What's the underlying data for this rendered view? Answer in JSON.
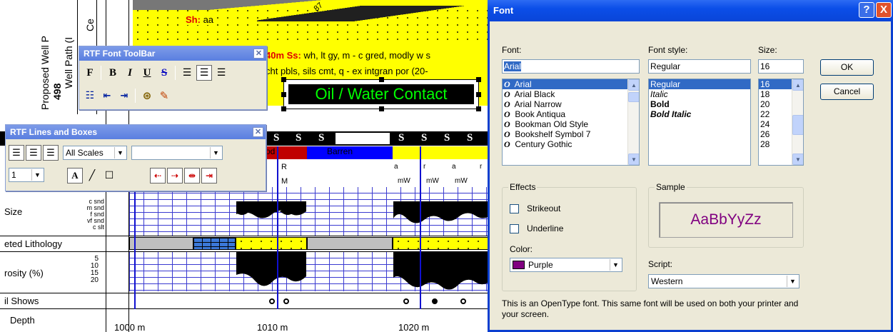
{
  "log": {
    "vertical_titles": [
      "Proposed Well P",
      "498",
      "Well Path (I",
      "Ce"
    ],
    "top_text": {
      "sh_prefix": "Sh:",
      "sh_value": "aa",
      "ss_prefix": "40m Ss:",
      "ss_line1": "wh, lt gy, m - c gred, modly w s",
      "ss_line2": "cht pbls, sils cmt, q - ex intgran por (20-",
      "angle": "87"
    },
    "contact_label": "Oil / Water Contact",
    "s_marks": [
      "S",
      "S",
      "S",
      "S",
      "S",
      "S",
      "S"
    ],
    "colored_bands": [
      "od",
      "Barren"
    ],
    "r_row": [
      "R",
      "a",
      "r",
      "a",
      "r"
    ],
    "m_row": [
      "M",
      "mW",
      "mW",
      "mW"
    ],
    "rows": [
      "Size",
      "eted Lithology",
      "rosity (%)",
      "il Shows",
      "Depth"
    ],
    "grain_sizes": [
      "c snd",
      "m snd",
      "f snd",
      "vf snd",
      "c slt"
    ],
    "porosity_ticks": [
      "5",
      "10",
      "15",
      "20"
    ],
    "depths": [
      "1000 m",
      "1010 m",
      "1020 m"
    ]
  },
  "rtf_toolbar": {
    "title": "RTF Font ToolBar",
    "buttons": [
      "F",
      "B",
      "I",
      "U",
      "S"
    ]
  },
  "lines_toolbar": {
    "title": "RTF Lines and Boxes",
    "scale_select": "All Scales",
    "line_width": "1",
    "text_button": "A"
  },
  "font_dialog": {
    "title": "Font",
    "font_label": "Font:",
    "font_value": "Arial",
    "fonts": [
      "Arial",
      "Arial Black",
      "Arial Narrow",
      "Book Antiqua",
      "Bookman Old Style",
      "Bookshelf Symbol 7",
      "Century Gothic"
    ],
    "style_label": "Font style:",
    "style_value": "Regular",
    "styles": [
      "Regular",
      "Italic",
      "Bold",
      "Bold Italic"
    ],
    "size_label": "Size:",
    "size_value": "16",
    "sizes": [
      "16",
      "18",
      "20",
      "22",
      "24",
      "26",
      "28"
    ],
    "ok": "OK",
    "cancel": "Cancel",
    "effects_label": "Effects",
    "strikeout": "Strikeout",
    "underline": "Underline",
    "color_label": "Color:",
    "color_value": "Purple",
    "color_hex": "#800080",
    "sample_label": "Sample",
    "sample_text": "AaBbYyZz",
    "script_label": "Script:",
    "script_value": "Western",
    "note": "This is an OpenType font. This same font will be used on both your printer and your screen.",
    "help_icon": "?",
    "close_icon": "X"
  }
}
